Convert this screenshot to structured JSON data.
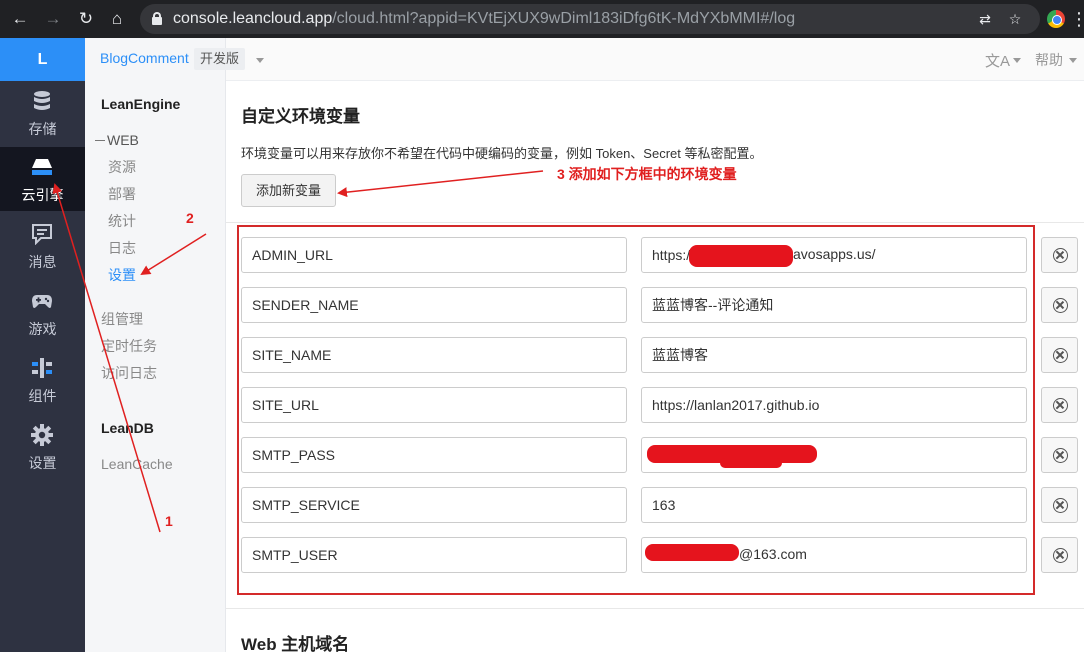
{
  "browser": {
    "url_host": "console.leancloud.app",
    "url_path": "/cloud.html?appid=KVtEjXUX9wDiml183iDfg6tK-MdYXbMMI#/log"
  },
  "leftnav": {
    "logo": "L",
    "items": [
      {
        "label": "存储",
        "icon": "database-icon"
      },
      {
        "label": "云引擎",
        "icon": "engine-icon",
        "active": true
      },
      {
        "label": "消息",
        "icon": "message-icon"
      },
      {
        "label": "游戏",
        "icon": "gamepad-icon"
      },
      {
        "label": "组件",
        "icon": "component-icon"
      },
      {
        "label": "设置",
        "icon": "gear-icon"
      }
    ]
  },
  "sidebar": {
    "section1_title": "LeanEngine",
    "web_group": "WEB",
    "web_items": [
      "资源",
      "部署",
      "统计",
      "日志",
      "设置"
    ],
    "other_items": [
      "组管理",
      "定时任务",
      "访问日志"
    ],
    "section2_title": "LeanDB",
    "section2_items": [
      "LeanCache"
    ]
  },
  "header": {
    "app_name": "BlogComment",
    "app_version": "开发版",
    "help": "帮助"
  },
  "main": {
    "title": "自定义环境变量",
    "description": "环境变量可以用来存放你不希望在代码中硬编码的变量，例如 Token、Secret 等私密配置。",
    "add_button": "添加新变量",
    "variables": [
      {
        "name": "ADMIN_URL",
        "value_prefix": "https://",
        "value_suffix": "avosapps.us/"
      },
      {
        "name": "SENDER_NAME",
        "value_prefix": "蓝蓝博客--评论通知",
        "value_suffix": ""
      },
      {
        "name": "SITE_NAME",
        "value_prefix": "蓝蓝博客",
        "value_suffix": ""
      },
      {
        "name": "SITE_URL",
        "value_prefix": "https://lanlan2017.github.io",
        "value_suffix": ""
      },
      {
        "name": "SMTP_PASS",
        "value_prefix": "",
        "value_suffix": ""
      },
      {
        "name": "SMTP_SERVICE",
        "value_prefix": "163",
        "value_suffix": ""
      },
      {
        "name": "SMTP_USER",
        "value_prefix": "",
        "value_suffix": "@163.com"
      }
    ],
    "web_domain_title": "Web 主机域名"
  },
  "annotations": {
    "label_1": "1",
    "label_2": "2",
    "label_3": "3 添加如下方框中的环境变量",
    "color": "#e02020"
  }
}
